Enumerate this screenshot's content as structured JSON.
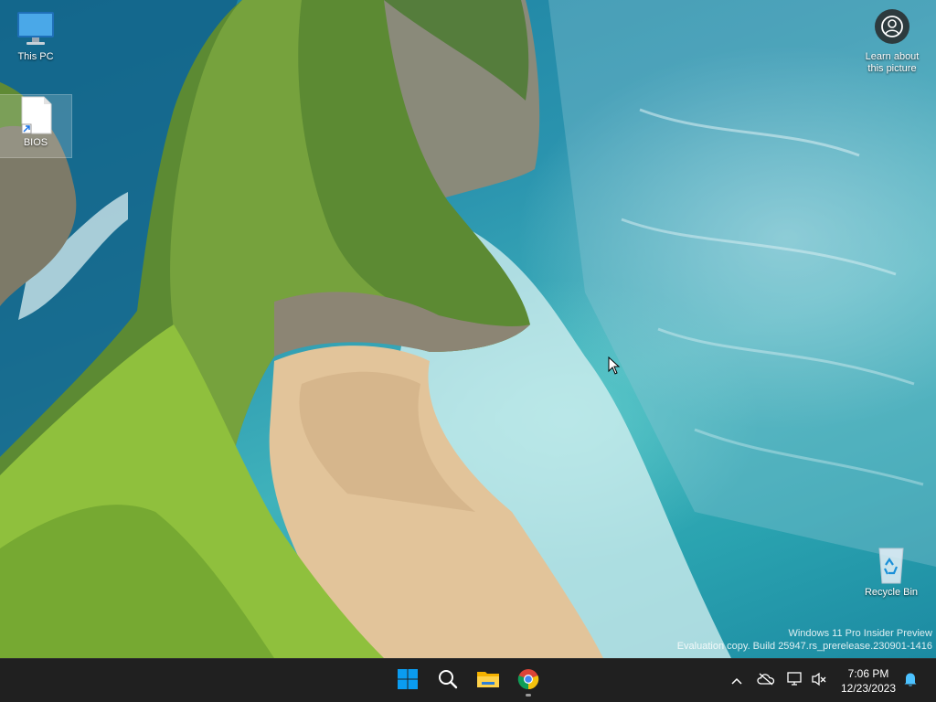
{
  "desktop": {
    "icons": [
      {
        "label": "This PC",
        "icon": "this-pc-icon"
      },
      {
        "label": "BIOS",
        "icon": "shortcut-file-icon"
      },
      {
        "label": "Recycle Bin",
        "icon": "recycle-bin-icon"
      }
    ],
    "spotlight": {
      "label_line1": "Learn about",
      "label_line2": "this picture",
      "icon": "camera-lens-icon"
    },
    "watermark": {
      "line1": "Windows 11 Pro Insider Preview",
      "line2": "Evaluation copy. Build 25947.rs_prerelease.230901-1416"
    }
  },
  "taskbar": {
    "apps": [
      {
        "name": "Start",
        "icon": "windows-start-icon"
      },
      {
        "name": "Search",
        "icon": "search-icon"
      },
      {
        "name": "File Explorer",
        "icon": "file-explorer-icon"
      },
      {
        "name": "Google Chrome",
        "icon": "chrome-icon",
        "running": true
      }
    ],
    "tray": {
      "icons": [
        "chevron-up-icon",
        "onedrive-offline-icon",
        "network-icon",
        "volume-muted-icon",
        "notification-bell-icon"
      ],
      "time": "7:06 PM",
      "date": "12/23/2023"
    }
  },
  "colors": {
    "taskbar": "#202020",
    "accent": "#0078d4",
    "notification": "#4cc2ff"
  }
}
